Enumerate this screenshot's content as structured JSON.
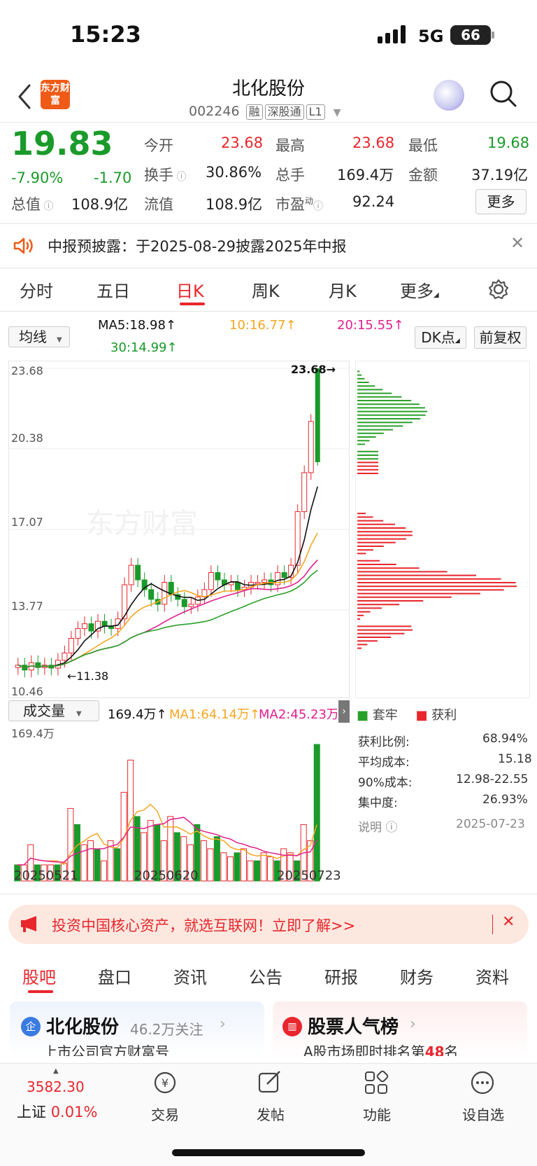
{
  "status_bar": {
    "time": "15:23",
    "network": "5G",
    "battery": "66"
  },
  "header": {
    "logo_text": "东方财富",
    "title": "北化股份",
    "code": "002246",
    "tags": [
      "融",
      "深股通",
      "L1"
    ]
  },
  "quote": {
    "price": "19.83",
    "change_pct": "-7.90%",
    "change": "-1.70",
    "open_label": "今开",
    "open": "23.68",
    "high_label": "最高",
    "high": "23.68",
    "low_label": "最低",
    "low": "19.68",
    "turnover_label": "换手",
    "turnover": "30.86%",
    "volume_label": "总手",
    "volume": "169.4万",
    "amount_label": "金额",
    "amount": "37.19亿",
    "mktcap_label": "总值",
    "mktcap": "108.9亿",
    "float_label": "流值",
    "float": "108.9亿",
    "pe_label": "市盈",
    "pe_sup": "动",
    "pe": "92.24",
    "more_label": "更多"
  },
  "notice": {
    "text": "中报预披露：于2025-08-29披露2025年中报"
  },
  "period_tabs": [
    "分时",
    "五日",
    "日K",
    "周K",
    "月K",
    "更多"
  ],
  "ma_bar": {
    "select_label": "均线",
    "ma5": "MA5:18.98↑",
    "ma10": "10:16.77↑",
    "ma20": "20:15.55↑",
    "ma30": "30:14.99↑",
    "dk_label": "DK点",
    "fq_label": "前复权"
  },
  "price_axis": [
    "23.68",
    "20.38",
    "17.07",
    "13.77",
    "10.46"
  ],
  "chart_labels": {
    "high_marker": "23.68→",
    "low_marker": "←11.38",
    "watermark": "东方财富"
  },
  "volume_bar": {
    "select_label": "成交量",
    "vol": "169.4万↑",
    "ma1": "MA1:64.14万↑",
    "ma2": "MA2:45.23万",
    "axis_top": "169.4万",
    "dates": [
      "20250521",
      "20250620",
      "20250723"
    ]
  },
  "chip": {
    "legend_trapped": "套牢",
    "legend_profit": "获利",
    "rows": [
      {
        "label": "获利比例:",
        "value": "68.94%"
      },
      {
        "label": "平均成本:",
        "value": "15.18"
      },
      {
        "label": "90%成本:",
        "value": "12.98-22.55"
      },
      {
        "label": "集中度:",
        "value": "26.93%"
      }
    ],
    "note_label": "说明",
    "date": "2025-07-23"
  },
  "ad": {
    "text": "投资中国核心资产，就选互联网！立即了解>>"
  },
  "bottom_tabs": [
    "股吧",
    "盘口",
    "资讯",
    "公告",
    "研报",
    "财务",
    "资料"
  ],
  "cards": [
    {
      "title": "北化股份",
      "meta": "46.2万关注",
      "sub": "上市公司官方财富号"
    },
    {
      "title": "股票人气榜",
      "sub_prefix": "A股市场即时排名第",
      "rank": "48",
      "sub_suffix": "名"
    }
  ],
  "bottom_nav": {
    "index_value": "3582.30",
    "index_name": "上证",
    "index_change": "0.01%",
    "items": [
      "交易",
      "发帖",
      "功能",
      "设自选"
    ]
  },
  "chart_data": {
    "type": "candlestick",
    "date_range": [
      "20250521",
      "20250723"
    ],
    "y_axis": [
      10.46,
      13.77,
      17.07,
      20.38,
      23.68
    ],
    "last_bar": {
      "open": 23.68,
      "high": 23.68,
      "low": 19.68,
      "close": 19.83,
      "volume": "169.4万"
    },
    "ma": {
      "MA5": 18.98,
      "MA10": 16.77,
      "MA20": 15.55,
      "MA30": 14.99
    },
    "colors": {
      "up": "#e8262c",
      "down": "#1a9a2a",
      "ma5": "#111111",
      "ma10": "#f5a623",
      "ma20": "#e0208f",
      "ma30": "#2aa02a"
    }
  }
}
